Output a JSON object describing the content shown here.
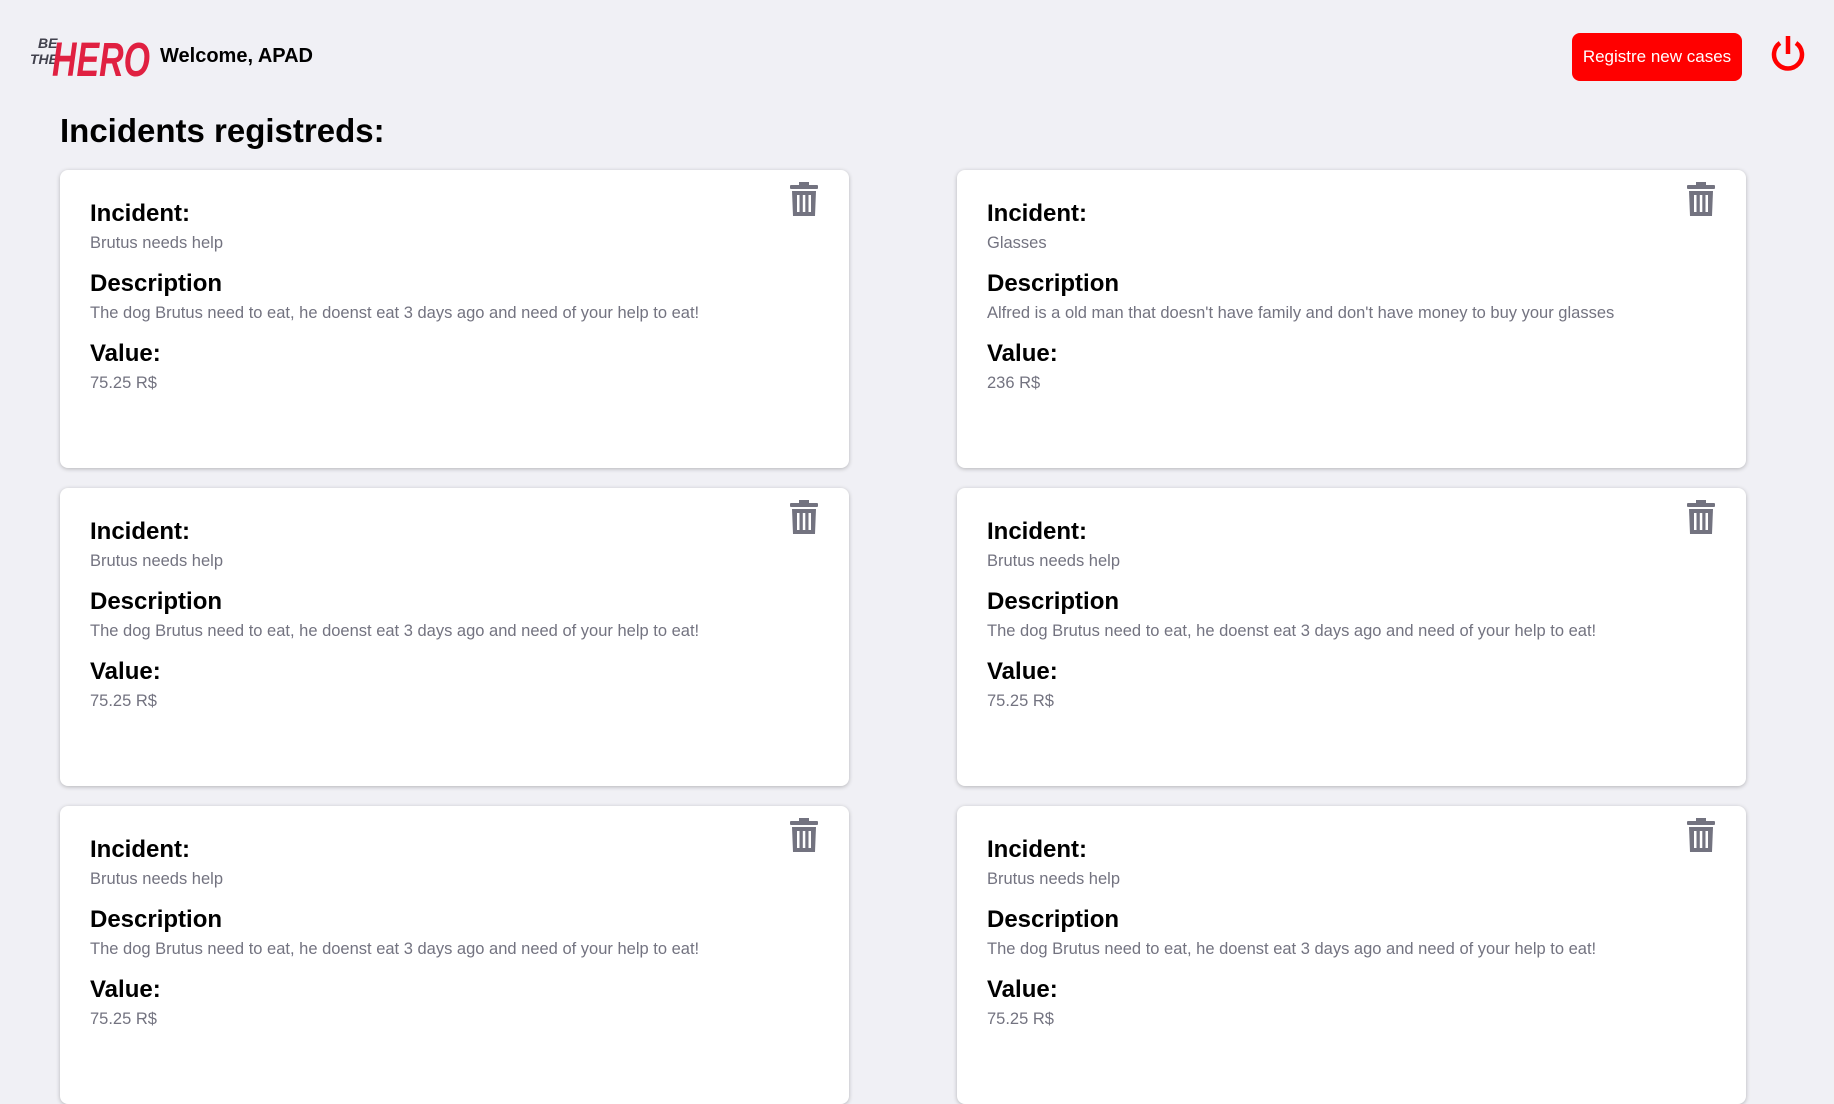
{
  "header": {
    "logo_text": "BE THE HERO",
    "welcome": "Welcome, APAD",
    "register_button": "Registre new cases"
  },
  "page_title": "Incidents registreds:",
  "labels": {
    "incident": "Incident:",
    "description": "Description",
    "value": "Value:"
  },
  "colors": {
    "accent": "#ff0000",
    "logo_red": "#e02041",
    "background": "#f0f0f5"
  },
  "incidents": [
    {
      "title": "Brutus needs help",
      "description": "The dog Brutus need to eat, he doenst eat 3 days ago and need of your help to eat!",
      "value": "75.25 R$"
    },
    {
      "title": "Glasses",
      "description": "Alfred is a old man that doesn't have family and don't have money to buy your glasses",
      "value": "236 R$"
    },
    {
      "title": "Brutus needs help",
      "description": "The dog Brutus need to eat, he doenst eat 3 days ago and need of your help to eat!",
      "value": "75.25 R$"
    },
    {
      "title": "Brutus needs help",
      "description": "The dog Brutus need to eat, he doenst eat 3 days ago and need of your help to eat!",
      "value": "75.25 R$"
    },
    {
      "title": "Brutus needs help",
      "description": "The dog Brutus need to eat, he doenst eat 3 days ago and need of your help to eat!",
      "value": "75.25 R$"
    },
    {
      "title": "Brutus needs help",
      "description": "The dog Brutus need to eat, he doenst eat 3 days ago and need of your help to eat!",
      "value": "75.25 R$"
    }
  ]
}
